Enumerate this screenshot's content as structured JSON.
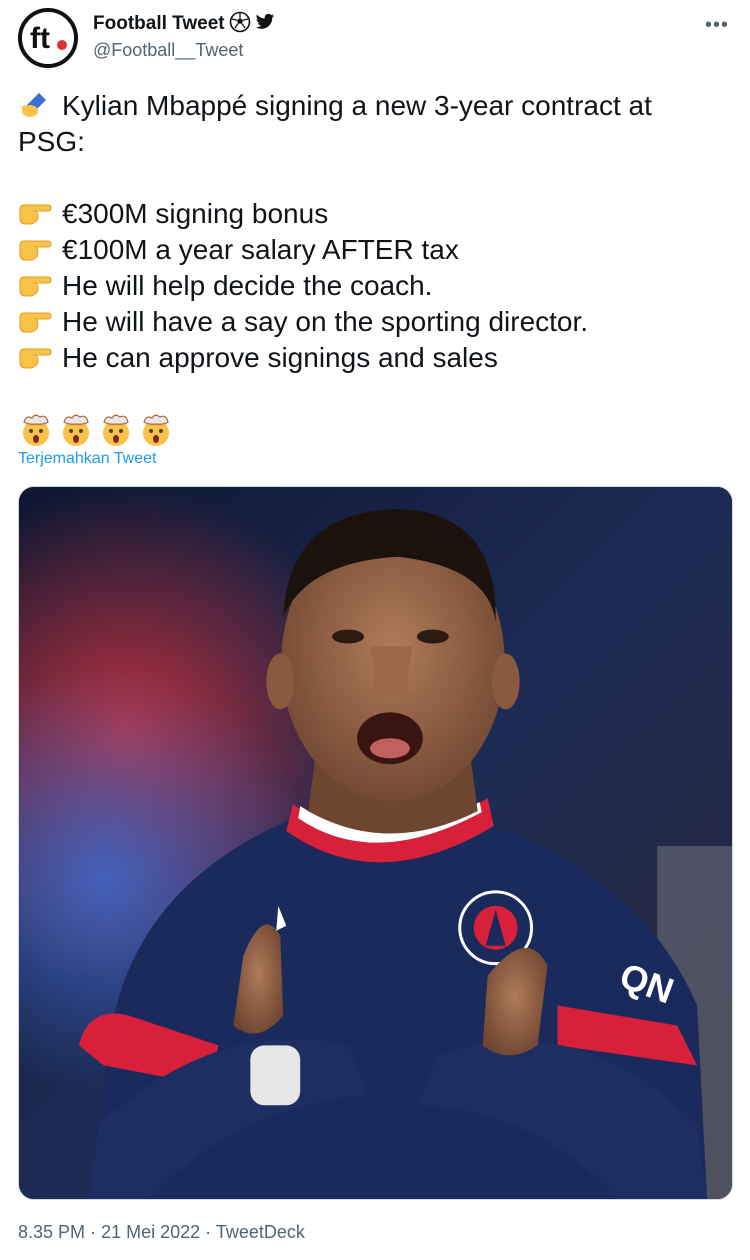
{
  "header": {
    "display_name": "Football Tweet",
    "handle": "@Football__Tweet",
    "more_label": "•••",
    "avatar_text": "ft",
    "icons": [
      "soccer-ball-icon",
      "twitter-bird-icon"
    ]
  },
  "tweet": {
    "lead_emoji": "writing-hand-icon",
    "lead_text": "Kylian Mbappé signing a new 3-year contract at PSG:",
    "bullet_emoji": "pointing-right-icon",
    "bullets": [
      "€300M signing bonus",
      "€100M a year salary AFTER tax",
      "He will help decide the coach.",
      "He will have a say on the sporting director.",
      "He can approve signings and sales"
    ],
    "reaction_emoji": "exploding-head-icon",
    "reaction_count": 4
  },
  "translate_label": "Terjemahkan Tweet",
  "photo": {
    "description_icon": "player-photo",
    "jersey_text": "QN"
  },
  "meta": {
    "time": "8.35 PM",
    "separator": "·",
    "date": "21 Mei 2022",
    "source": "TweetDeck"
  },
  "colors": {
    "link": "#1d9bf0",
    "secondary": "#536471",
    "psg_navy": "#1b2a5c",
    "psg_red": "#d8203a"
  }
}
